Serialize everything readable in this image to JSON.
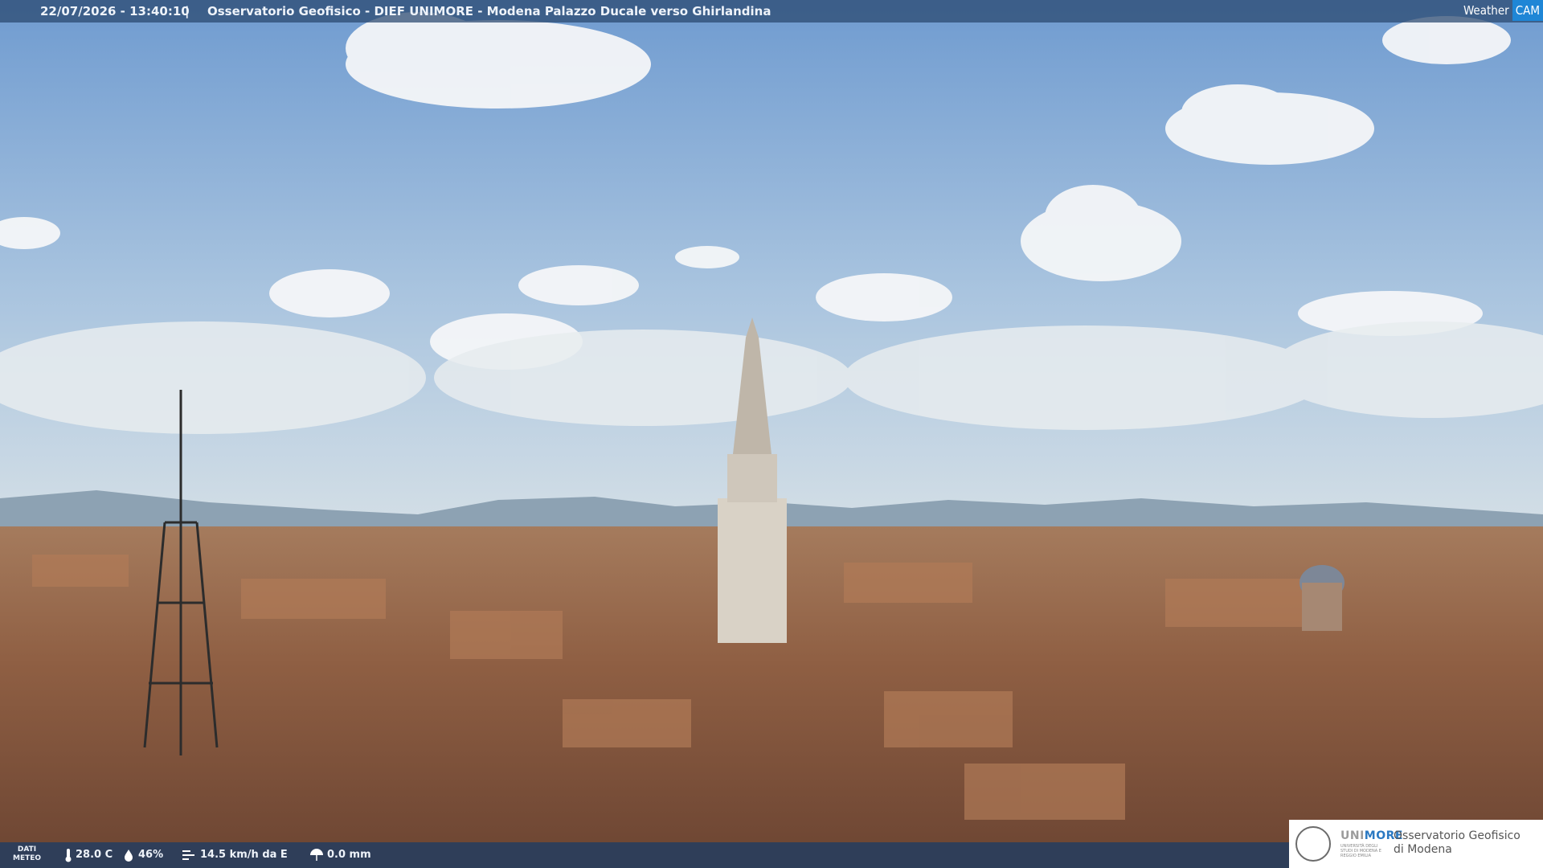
{
  "overlay": {
    "timestamp": "22/07/2026 - 13:40:10",
    "separator": "|",
    "title": "Osservatorio Geofisico - DIEF UNIMORE - Modena Palazzo Ducale verso Ghirlandina",
    "brand_weather": "Weather",
    "brand_cam": "CAM"
  },
  "weather": {
    "label_line1": "DATI",
    "label_line2": "METEO",
    "temperature": "28.0 C",
    "humidity": "46%",
    "wind": "14.5 km/h da E",
    "rain": "0.0 mm"
  },
  "logo": {
    "uni": "UNI",
    "more": "MORE",
    "subtitle": "UNIVERSITÀ DEGLI STUDI DI MODENA E REGGIO EMILIA",
    "line1": "Osservatorio Geofisico",
    "line2": "di Modena"
  },
  "colors": {
    "sky_top": "#6f9bd0",
    "sky_bottom": "#c9dbe8",
    "roofs": "#9a6a4c",
    "accent_blue": "#2b79c2"
  }
}
